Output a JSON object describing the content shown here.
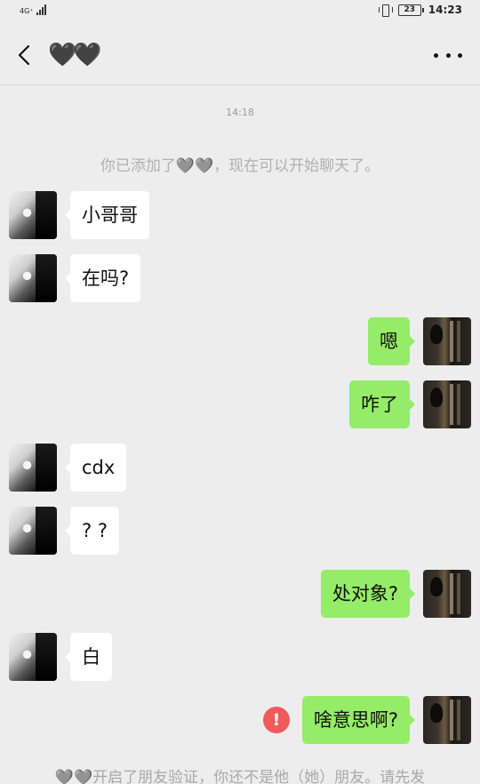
{
  "status_bar": {
    "network": "4G⁺",
    "battery": "23",
    "time": "14:23"
  },
  "header": {
    "title": "🖤🖤"
  },
  "chat": {
    "timestamp": "14:18",
    "system_note": "你已添加了🩶🩶，现在可以开始聊天了。",
    "messages": [
      {
        "from": "contact",
        "text": "小哥哥"
      },
      {
        "from": "contact",
        "text": "在吗?"
      },
      {
        "from": "me",
        "text": "嗯"
      },
      {
        "from": "me",
        "text": "咋了"
      },
      {
        "from": "contact",
        "text": "cdx"
      },
      {
        "from": "contact",
        "text": "? ?"
      },
      {
        "from": "me",
        "text": "处对象?"
      },
      {
        "from": "contact",
        "text": "白"
      },
      {
        "from": "me",
        "text": "啥意思啊?",
        "failed": true
      }
    ],
    "error_mark": "!",
    "footer_note": "🩶🩶开启了朋友验证，你还不是他（她）朋友。请先发"
  },
  "colors": {
    "background": "#ededed",
    "bubble_out": "#95ec69",
    "bubble_in": "#ffffff",
    "error": "#f05a5a"
  },
  "icons": {
    "back": "chevron-left-icon",
    "more": "more-dots-icon",
    "error": "exclamation-icon"
  }
}
